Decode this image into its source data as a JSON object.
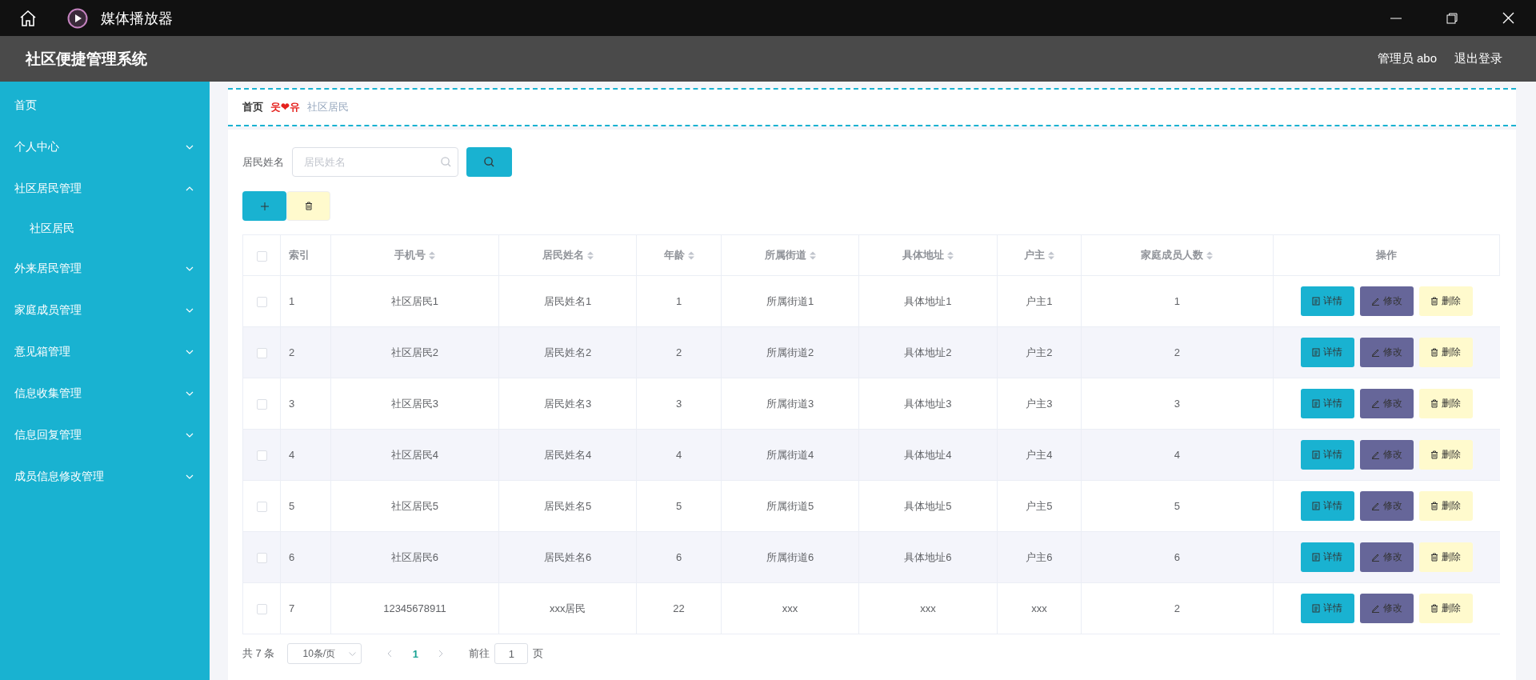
{
  "window": {
    "title": "媒体播放器"
  },
  "header": {
    "title": "社区便捷管理系统",
    "user": "管理员 abo",
    "logout": "退出登录"
  },
  "sidebar": {
    "items": [
      {
        "label": "首页",
        "kind": "link"
      },
      {
        "label": "个人中心",
        "kind": "group",
        "expanded": false
      },
      {
        "label": "社区居民管理",
        "kind": "group",
        "expanded": true,
        "children": [
          {
            "label": "社区居民"
          }
        ]
      },
      {
        "label": "外来居民管理",
        "kind": "group",
        "expanded": false
      },
      {
        "label": "家庭成员管理",
        "kind": "group",
        "expanded": false
      },
      {
        "label": "意见箱管理",
        "kind": "group",
        "expanded": false
      },
      {
        "label": "信息收集管理",
        "kind": "group",
        "expanded": false
      },
      {
        "label": "信息回复管理",
        "kind": "group",
        "expanded": false
      },
      {
        "label": "成员信息修改管理",
        "kind": "group",
        "expanded": false
      }
    ]
  },
  "breadcrumb": {
    "home": "首页",
    "separator": "웃❤유",
    "current": "社区居民"
  },
  "search": {
    "label": "居民姓名",
    "placeholder": "居民姓名"
  },
  "table": {
    "columns": [
      {
        "label": "索引",
        "sortable": false
      },
      {
        "label": "手机号",
        "sortable": true
      },
      {
        "label": "居民姓名",
        "sortable": true
      },
      {
        "label": "年龄",
        "sortable": true
      },
      {
        "label": "所属街道",
        "sortable": true
      },
      {
        "label": "具体地址",
        "sortable": true
      },
      {
        "label": "户主",
        "sortable": true
      },
      {
        "label": "家庭成员人数",
        "sortable": true
      },
      {
        "label": "操作",
        "sortable": false
      }
    ],
    "rows": [
      {
        "checked": false,
        "cells": [
          "1",
          "社区居民1",
          "居民姓名1",
          "1",
          "所属街道1",
          "具体地址1",
          "户主1",
          "1"
        ],
        "actions": [
          {
            "label": "详情",
            "kind": "detail"
          },
          {
            "label": "修改",
            "kind": "edit"
          },
          {
            "label": "删除",
            "kind": "delete"
          }
        ]
      },
      {
        "checked": false,
        "cells": [
          "2",
          "社区居民2",
          "居民姓名2",
          "2",
          "所属街道2",
          "具体地址2",
          "户主2",
          "2"
        ],
        "actions": [
          {
            "label": "详情",
            "kind": "detail"
          },
          {
            "label": "修改",
            "kind": "edit"
          },
          {
            "label": "删除",
            "kind": "delete"
          }
        ]
      },
      {
        "checked": false,
        "cells": [
          "3",
          "社区居民3",
          "居民姓名3",
          "3",
          "所属街道3",
          "具体地址3",
          "户主3",
          "3"
        ],
        "actions": [
          {
            "label": "详情",
            "kind": "detail"
          },
          {
            "label": "修改",
            "kind": "edit"
          },
          {
            "label": "删除",
            "kind": "delete"
          }
        ]
      },
      {
        "checked": false,
        "cells": [
          "4",
          "社区居民4",
          "居民姓名4",
          "4",
          "所属街道4",
          "具体地址4",
          "户主4",
          "4"
        ],
        "actions": [
          {
            "label": "详情",
            "kind": "detail"
          },
          {
            "label": "修改",
            "kind": "edit"
          },
          {
            "label": "删除",
            "kind": "delete"
          }
        ]
      },
      {
        "checked": false,
        "cells": [
          "5",
          "社区居民5",
          "居民姓名5",
          "5",
          "所属街道5",
          "具体地址5",
          "户主5",
          "5"
        ],
        "actions": [
          {
            "label": "详情",
            "kind": "detail"
          },
          {
            "label": "修改",
            "kind": "edit"
          },
          {
            "label": "删除",
            "kind": "delete"
          }
        ]
      },
      {
        "checked": false,
        "cells": [
          "6",
          "社区居民6",
          "居民姓名6",
          "6",
          "所属街道6",
          "具体地址6",
          "户主6",
          "6"
        ],
        "actions": [
          {
            "label": "详情",
            "kind": "detail"
          },
          {
            "label": "修改",
            "kind": "edit"
          },
          {
            "label": "删除",
            "kind": "delete"
          }
        ]
      },
      {
        "checked": false,
        "cells": [
          "7",
          "12345678911",
          "xxx居民",
          "22",
          "xxx",
          "xxx",
          "xxx",
          "2"
        ],
        "actions": [
          {
            "label": "详情",
            "kind": "detail"
          },
          {
            "label": "修改",
            "kind": "edit"
          },
          {
            "label": "删除",
            "kind": "delete"
          }
        ]
      }
    ],
    "all_checked": false
  },
  "pagination": {
    "total": "共 7 条",
    "page_size": "10条/页",
    "pages": [
      {
        "label": "1",
        "selected": true
      }
    ],
    "goto_label": "前往",
    "goto_value": "1",
    "goto_suffix": "页"
  }
}
